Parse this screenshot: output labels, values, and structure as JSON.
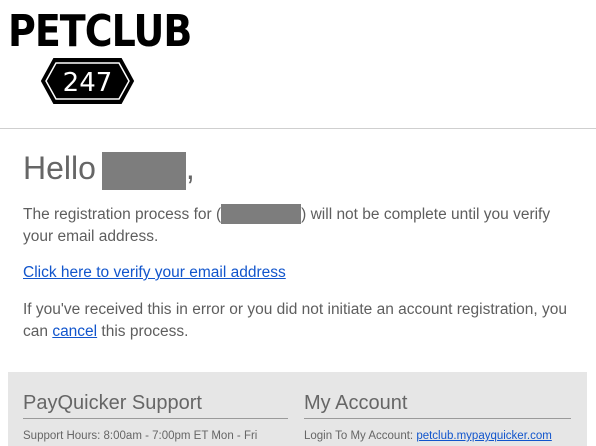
{
  "brand": {
    "wordmark": "PETCLUB",
    "badge_text": "247"
  },
  "greeting": {
    "hello": "Hello",
    "comma": ","
  },
  "message": {
    "p1_before": "The registration process for (",
    "p1_after": ") will not be complete until you verify your email address.",
    "verify_link": "Click here to verify your email address",
    "p3_before": "If you've received this in error or you did not initiate an account registration, you can ",
    "cancel_link": "cancel",
    "p3_after": " this process."
  },
  "footer": {
    "support": {
      "heading": "PayQuicker Support",
      "hours": "Support Hours: 8:00am - 7:00pm ET Mon - Fri"
    },
    "account": {
      "heading": "My Account",
      "login_label": "Login To My Account: ",
      "login_link": "petclub.mypayquicker.com"
    }
  },
  "colors": {
    "link": "#1155cc",
    "redaction": "#7d7d7d",
    "footer_bg": "#e6e6e6"
  }
}
